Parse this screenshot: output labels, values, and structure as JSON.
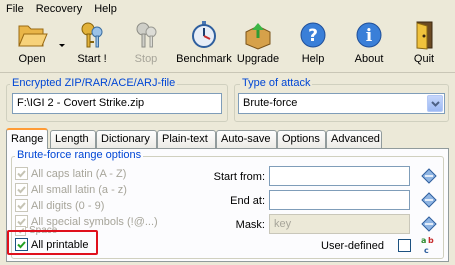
{
  "menu": [
    "File",
    "Recovery",
    "Help"
  ],
  "toolbar": {
    "open": "Open",
    "start": "Start !",
    "stop": "Stop",
    "benchmark": "Benchmark",
    "upgrade": "Upgrade",
    "help": "Help",
    "about": "About",
    "quit": "Quit"
  },
  "file_group": {
    "title": "Encrypted ZIP/RAR/ACE/ARJ-file",
    "value": "F:\\IGI 2 - Covert Strike.zip"
  },
  "attack_group": {
    "title": "Type of attack",
    "selected": "Brute-force"
  },
  "tabs": [
    "Range",
    "Length",
    "Dictionary",
    "Plain-text",
    "Auto-save",
    "Options",
    "Advanced"
  ],
  "range": {
    "title": "Brute-force range options",
    "options": [
      {
        "label": "All caps latin (A - Z)",
        "checked": true,
        "enabled": false
      },
      {
        "label": "All small latin (a - z)",
        "checked": true,
        "enabled": false
      },
      {
        "label": "All digits (0 - 9)",
        "checked": true,
        "enabled": false
      },
      {
        "label": "All special symbols (!@...)",
        "checked": true,
        "enabled": false
      },
      {
        "label": "Space",
        "checked": true,
        "enabled": false
      },
      {
        "label": "All printable",
        "checked": true,
        "enabled": true
      }
    ],
    "start_from_label": "Start from:",
    "start_from_value": "",
    "end_at_label": "End at:",
    "end_at_value": "",
    "mask_label": "Mask:",
    "mask_placeholder": "key",
    "user_defined_label": "User-defined"
  },
  "colors": {
    "accent": "#0046d5",
    "highlight": "#e0101c",
    "tab_active_border": "#ff9b35"
  }
}
